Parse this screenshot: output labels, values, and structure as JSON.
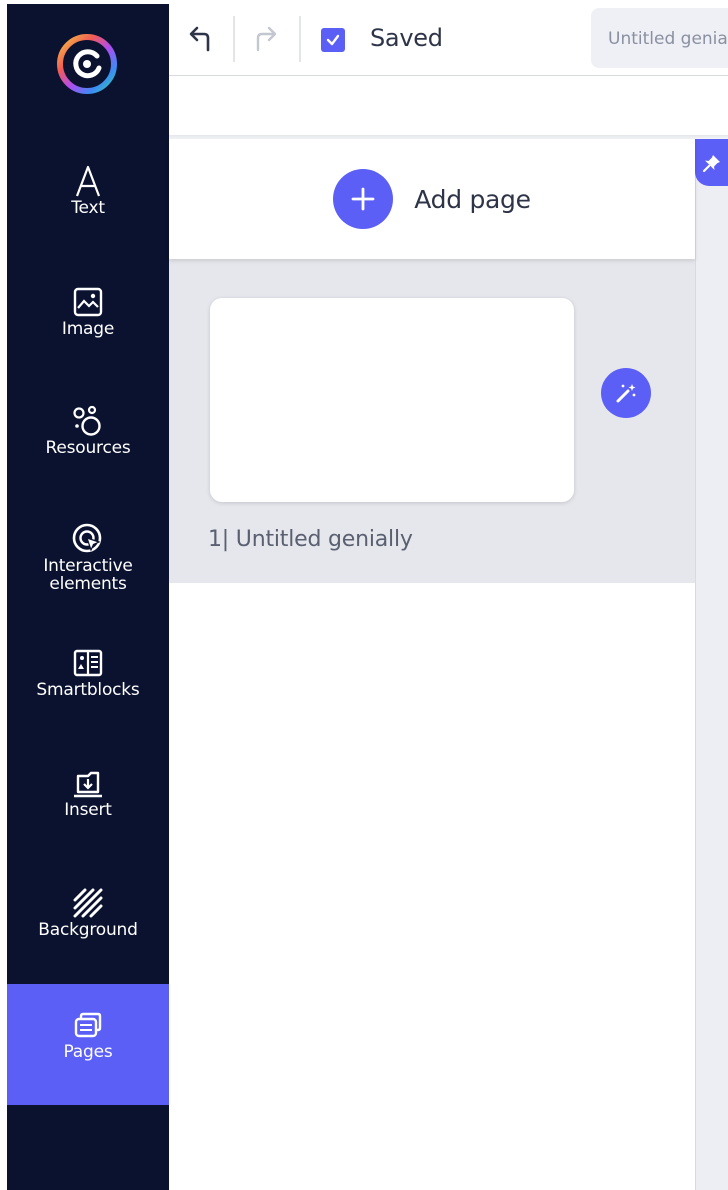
{
  "toolbar": {
    "undo_icon": "undo-icon",
    "redo_icon": "redo-icon",
    "saved_label": "Saved",
    "document_title": "Untitled genially"
  },
  "sidebar": {
    "logo_icon": "genially-logo",
    "items": [
      {
        "label": "Text",
        "icon": "text-a-icon"
      },
      {
        "label": "Image",
        "icon": "image-icon"
      },
      {
        "label": "Resources",
        "icon": "resources-icon"
      },
      {
        "label": "Interactive elements",
        "label_line1": "Interactive",
        "label_line2": "elements",
        "icon": "interactive-icon"
      },
      {
        "label": "Smartblocks",
        "icon": "smartblocks-icon"
      },
      {
        "label": "Insert",
        "icon": "insert-icon"
      },
      {
        "label": "Background",
        "icon": "background-icon"
      },
      {
        "label": "Pages",
        "icon": "pages-icon",
        "active": true
      }
    ]
  },
  "pages_panel": {
    "add_page_label": "Add page",
    "pages": [
      {
        "number": "1",
        "separator": "|",
        "caption": "1| Untitled genially",
        "title": "Untitled genially"
      }
    ]
  },
  "colors": {
    "sidebar_bg": "#0b1230",
    "accent": "#5b5ff6",
    "panel_gray": "#e5e7ec"
  }
}
